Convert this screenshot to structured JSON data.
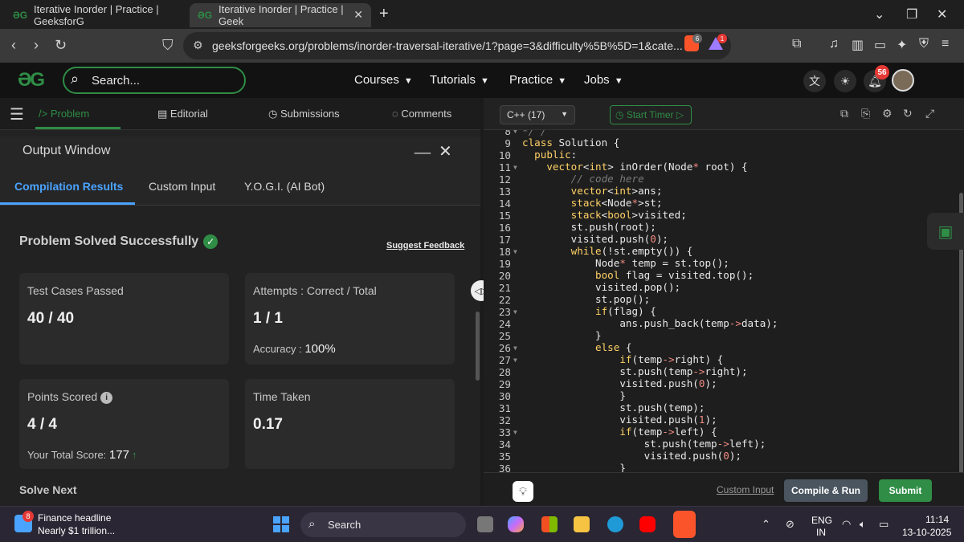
{
  "browser": {
    "tabs": [
      {
        "label": "Iterative Inorder | Practice | GeeksforG"
      },
      {
        "label": "Iterative Inorder | Practice | Geek"
      }
    ],
    "url": "geeksforgeeks.org/problems/inorder-traversal-iterative/1?page=3&difficulty%5B%5D=1&cate...",
    "brave_badge": "6",
    "alert_badge": "1"
  },
  "gfg_header": {
    "logo": "ƏG",
    "search_placeholder": "Search...",
    "menus": [
      "Courses",
      "Tutorials",
      "Practice",
      "Jobs"
    ],
    "notification_count": "56"
  },
  "problem_tabs": [
    "Problem",
    "Editorial",
    "Submissions",
    "Comments"
  ],
  "output_window": {
    "title": "Output Window",
    "tabs": [
      "Compilation Results",
      "Custom Input",
      "Y.O.G.I. (AI Bot)"
    ],
    "status": "Problem Solved Successfully",
    "feedback_link": "Suggest Feedback",
    "cards": {
      "test_cases_label": "Test Cases Passed",
      "test_cases_value": "40 / 40",
      "attempts_label": "Attempts : Correct / Total",
      "attempts_value": "1 / 1",
      "accuracy_label": "Accuracy :",
      "accuracy_value": "100%",
      "points_label": "Points Scored",
      "points_value": "4 / 4",
      "total_score_label": "Your Total Score:",
      "total_score_value": "177",
      "time_label": "Time Taken",
      "time_value": "0.17"
    },
    "solve_next": "Solve Next"
  },
  "editor": {
    "language": "C++ (17)",
    "timer_label": "Start Timer",
    "line_numbers": [
      "8",
      "9",
      "10",
      "11",
      "12",
      "13",
      "14",
      "15",
      "16",
      "17",
      "18",
      "19",
      "20",
      "21",
      "22",
      "23",
      "24",
      "25",
      "26",
      "27",
      "28",
      "29",
      "30",
      "31",
      "32",
      "33",
      "34",
      "35",
      "36"
    ],
    "custom_input_link": "Custom Input",
    "compile_label": "Compile & Run",
    "submit_label": "Submit"
  },
  "taskbar": {
    "news_badge": "8",
    "news_title": "Finance headline",
    "news_sub": "Nearly $1 trillion...",
    "search_label": "Search",
    "lang_top": "ENG",
    "lang_bot": "IN",
    "time": "11:14",
    "date": "13-10-2025"
  }
}
